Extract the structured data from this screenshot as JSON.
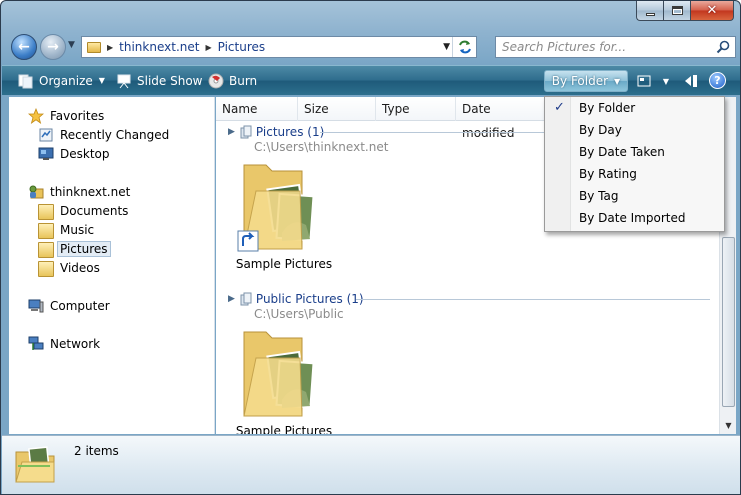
{
  "window": {
    "close_glyph": "✕"
  },
  "address_bar": {
    "crumbs": [
      "thinknext.net",
      "Pictures"
    ]
  },
  "search": {
    "placeholder": "Search Pictures for..."
  },
  "toolbar": {
    "organize_label": "Organize",
    "slideshow_label": "Slide Show",
    "burn_label": "Burn",
    "arrange_label": "By Folder",
    "help_label": "?"
  },
  "navigation": {
    "favorites": {
      "label": "Favorites",
      "items": [
        {
          "label": "Recently Changed",
          "icon": "recently-changed-icon"
        },
        {
          "label": "Desktop",
          "icon": "desktop-icon"
        }
      ]
    },
    "user": {
      "label": "thinknext.net",
      "items": [
        {
          "label": "Documents",
          "icon": "folder-icon"
        },
        {
          "label": "Music",
          "icon": "folder-icon"
        },
        {
          "label": "Pictures",
          "icon": "folder-icon",
          "selected": true
        },
        {
          "label": "Videos",
          "icon": "folder-icon"
        }
      ]
    },
    "computer_label": "Computer",
    "network_label": "Network"
  },
  "columns": [
    "Name",
    "Size",
    "Type",
    "Date modified"
  ],
  "groups": [
    {
      "title": "Pictures (1)",
      "path": "C:\\Users\\thinknext.net",
      "item_label": "Sample Pictures",
      "shortcut": true
    },
    {
      "title": "Public Pictures (1)",
      "path": "C:\\Users\\Public",
      "item_label": "Sample Pictures",
      "shortcut": false
    }
  ],
  "details_pane": {
    "item_count": "2 items"
  },
  "arrange_menu": {
    "items": [
      {
        "label": "By Folder",
        "checked": true
      },
      {
        "label": "By Day",
        "checked": false
      },
      {
        "label": "By Date Taken",
        "checked": false
      },
      {
        "label": "By Rating",
        "checked": false
      },
      {
        "label": "By Tag",
        "checked": false
      },
      {
        "label": "By Date Imported",
        "checked": false
      }
    ],
    "check_glyph": "✓"
  },
  "colors": {
    "toolbar": "#2e6c8c",
    "link_blue": "#1a3e8a",
    "selection": "#e3ecf5"
  }
}
